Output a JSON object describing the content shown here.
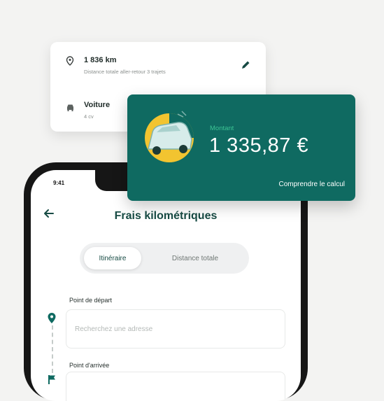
{
  "distance_card": {
    "distance": "1 836 km",
    "distance_desc": "Distance totale aller-retour 3 trajets",
    "vehicle": "Voiture",
    "vehicle_sub": "4 cv"
  },
  "amount_card": {
    "label": "Montant",
    "value": "1 335,87 €",
    "link": "Comprendre le calcul"
  },
  "phone": {
    "time": "9:41",
    "title": "Frais kilométriques",
    "tabs": [
      "Itinéraire",
      "Distance totale"
    ],
    "start_label": "Point de départ",
    "start_placeholder": "Recherchez une adresse",
    "end_label": "Point d'arrivée"
  },
  "colors": {
    "brand": "#0f6a61",
    "accent": "#3cc494",
    "yellow": "#f2c430"
  }
}
